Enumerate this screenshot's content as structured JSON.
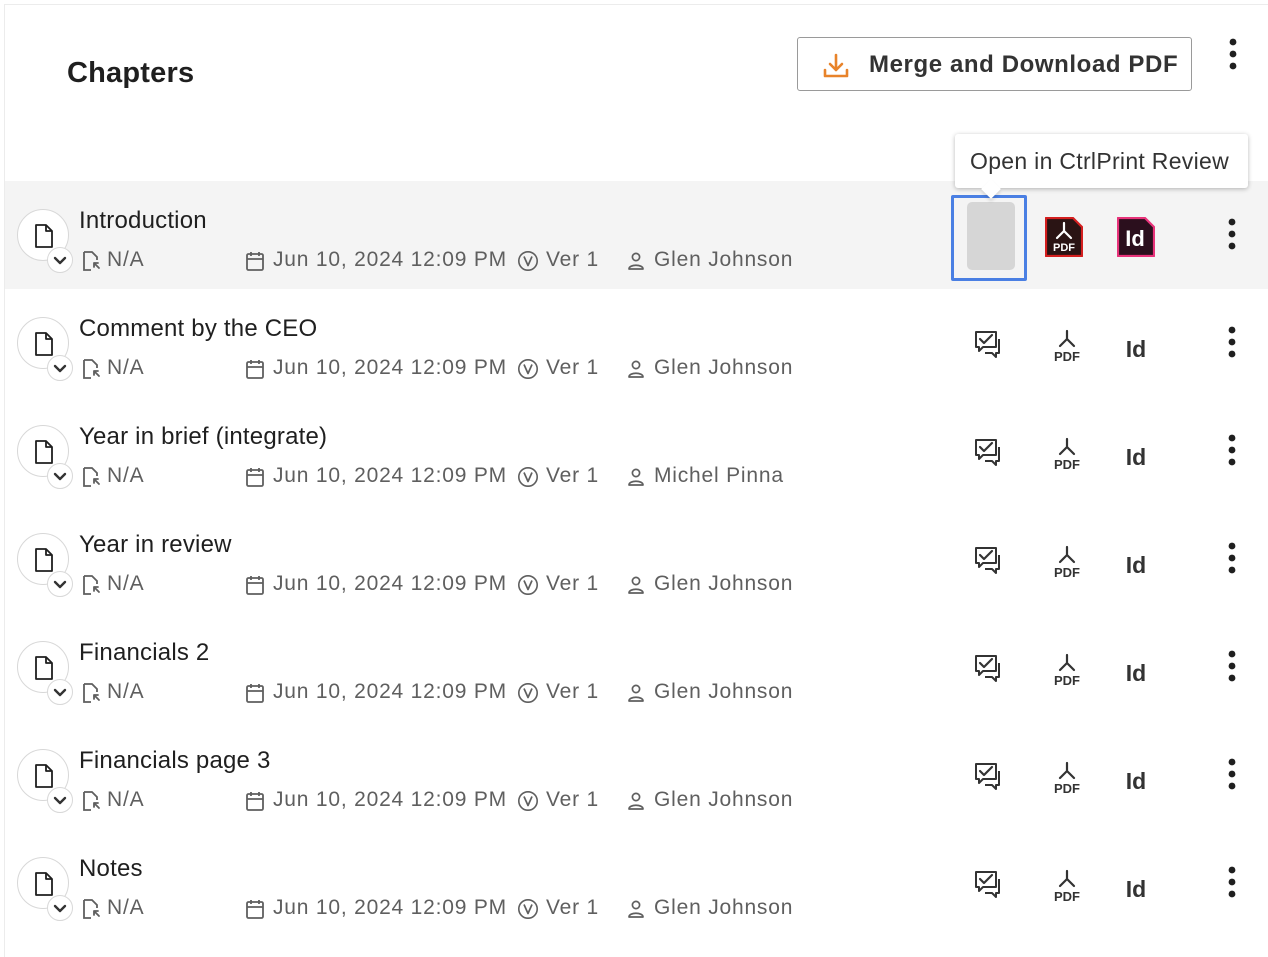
{
  "page_title": "Chapters",
  "merge_button_label": "Merge and Download PDF",
  "tooltip_text": "Open in CtrlPrint Review",
  "colors": {
    "accent_orange": "#e8832a",
    "pdf_red": "#d41f1f",
    "indesign_pink": "#e8337a",
    "focus_blue": "#4a7fe3"
  },
  "rows": [
    {
      "name": "Introduction",
      "status": "N/A",
      "date": "Jun 10, 2024 12:09 PM",
      "version": "Ver 1",
      "author": "Glen Johnson"
    },
    {
      "name": "Comment by the CEO",
      "status": "N/A",
      "date": "Jun 10, 2024 12:09 PM",
      "version": "Ver 1",
      "author": "Glen Johnson"
    },
    {
      "name": "Year in brief (integrate)",
      "status": "N/A",
      "date": "Jun 10, 2024 12:09 PM",
      "version": "Ver 1",
      "author": "Michel Pinna"
    },
    {
      "name": "Year in review",
      "status": "N/A",
      "date": "Jun 10, 2024 12:09 PM",
      "version": "Ver 1",
      "author": "Glen Johnson"
    },
    {
      "name": "Financials 2",
      "status": "N/A",
      "date": "Jun 10, 2024 12:09 PM",
      "version": "Ver 1",
      "author": "Glen Johnson"
    },
    {
      "name": "Financials page 3",
      "status": "N/A",
      "date": "Jun 10, 2024 12:09 PM",
      "version": "Ver 1",
      "author": "Glen Johnson"
    },
    {
      "name": "Notes",
      "status": "N/A",
      "date": "Jun 10, 2024 12:09 PM",
      "version": "Ver 1",
      "author": "Glen Johnson"
    }
  ],
  "icons": {
    "download": "download-icon",
    "more": "more-vert-icon",
    "document": "document-icon",
    "expand": "chevron-down-icon",
    "status": "file-status-icon",
    "calendar": "calendar-icon",
    "version": "version-icon",
    "person": "person-icon",
    "review": "ctrlprint-review-icon",
    "pdf": "pdf-icon",
    "indesign": "indesign-icon"
  },
  "pdf_text": "PDF",
  "indesign_text": "Id"
}
